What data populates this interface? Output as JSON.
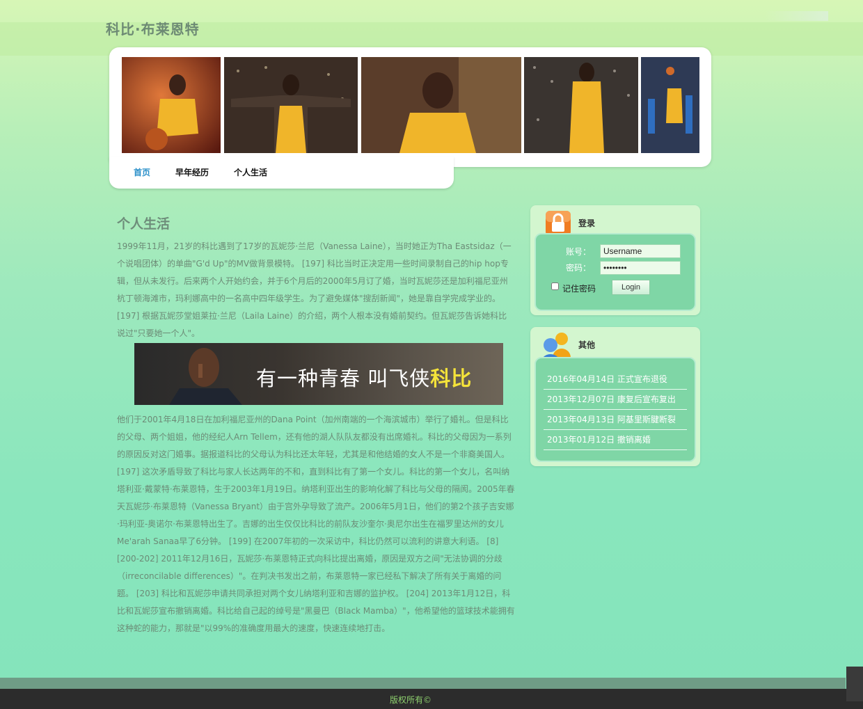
{
  "site": {
    "title": "科比·布莱恩特"
  },
  "nav": {
    "items": [
      {
        "label": "首页",
        "active": true
      },
      {
        "label": "早年经历",
        "active": false
      },
      {
        "label": "个人生活",
        "active": false
      }
    ]
  },
  "content": {
    "heading": "个人生活",
    "para1": "1999年11月，21岁的科比遇到了17岁的瓦妮莎·兰尼（Vanessa Laine），当时她正为Tha Eastsidaz（一个说唱团体）的单曲\"G'd Up\"的MV做背景模特。 [197] 科比当时正决定用一些时间录制自己的hip hop专辑，但从未发行。后来两个人开始约会，并于6个月后的2000年5月订了婚，当时瓦妮莎还是加利福尼亚州杭丁顿海滩市，玛利娜高中的一名高中四年级学生。为了避免媒体\"搜刮新闻\"，她是靠自学完成学业的。 [197] 根据瓦妮莎堂姐莱拉·兰尼（Laila Laine）的介绍，两个人根本没有婚前契约。但瓦妮莎告诉她科比说过\"只要她一个人\"。",
    "promo_text": "有一种青春  叫飞侠",
    "promo_highlight": "科比",
    "para2": "他们于2001年4月18日在加利福尼亚州的Dana Point（加州南端的一个海滨城市）举行了婚礼。但是科比的父母、两个姐姐，他的经纪人Arn Tellem，还有他的湖人队队友都没有出席婚礼。科比的父母因为一系列的原因反对这门婚事。据报道科比的父母认为科比还太年轻，尤其是和他结婚的女人不是一个非裔美国人。 [197] 这次矛盾导致了科比与家人长达两年的不和，直到科比有了第一个女儿。科比的第一个女儿，名叫纳塔利亚·戴蒙特·布莱恩特，生于2003年1月19日。纳塔利亚出生的影响化解了科比与父母的隔阂。2005年春天瓦妮莎·布莱恩特（Vanessa Bryant）由于宫外孕导致了流产。2006年5月1日，他们的第2个孩子吉安娜·玛利亚-奥诺尔·布莱恩特出生了。吉娜的出生仅仅比科比的前队友沙奎尔·奥尼尔出生在福罗里达州的女儿Me'arah Sanaa早了6分钟。 [199] 在2007年初的一次采访中，科比仍然可以流利的讲意大利语。 [8] [200-202] 2011年12月16日，瓦妮莎·布莱恩特正式向科比提出离婚，原因是双方之间\"无法协调的分歧（irreconcilable differences）\"。在判决书发出之前，布莱恩特一家已经私下解决了所有关于离婚的问题。 [203] 科比和瓦妮莎申请共同承担对两个女儿纳塔利亚和吉娜的监护权。 [204] 2013年1月12日，科比和瓦妮莎宣布撤销离婚。科比给自己起的绰号是\"黑曼巴（Black Mamba）\"，他希望他的篮球技术能拥有这种蛇的能力，那就是\"以99%的准确度用最大的速度，快速连续地打击。"
  },
  "login": {
    "title": "登录",
    "username_label": "账号：",
    "password_label": "密码：",
    "username_value": "Username",
    "password_value": "••••••••",
    "remember_label": "记住密码",
    "button_label": "Login"
  },
  "other": {
    "title": "其他",
    "items": [
      "2016年04月14日 正式宣布退役",
      "2013年12月07日 康复后宣布复出",
      "2013年04月13日 阿基里斯腱断裂",
      "2013年01月12日 撤销离婚"
    ]
  },
  "footer": {
    "text": "版权所有©"
  },
  "colors": {
    "accent_nav": "#2a8fc9",
    "promo_highlight": "#f5e33a",
    "footer_text": "#8ed06e"
  }
}
